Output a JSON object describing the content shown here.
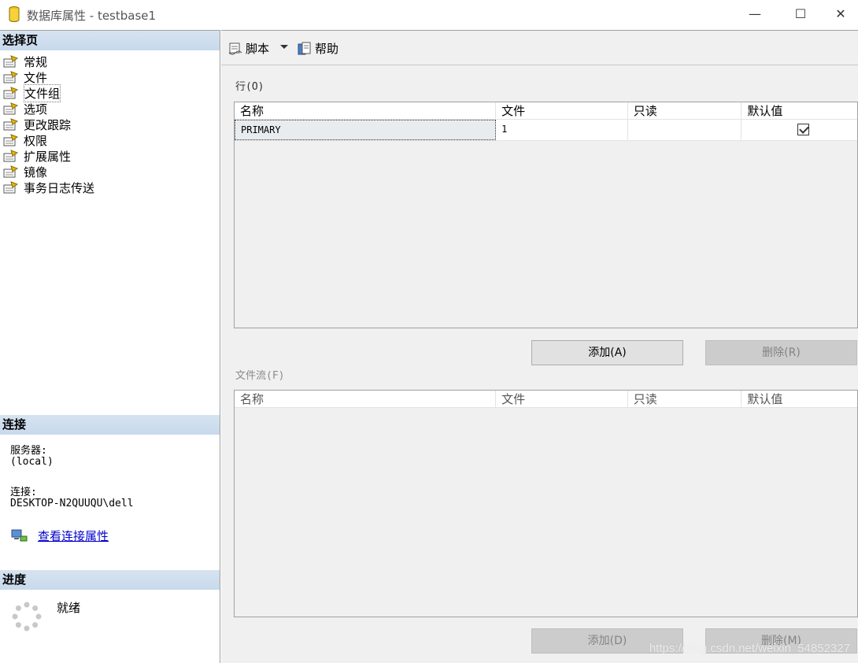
{
  "window": {
    "title": "数据库属性 - testbase1",
    "minimize_glyph": "—",
    "maximize_glyph": "☐",
    "close_glyph": "✕"
  },
  "sidebar": {
    "select_page_header": "选择页",
    "items": [
      {
        "label": "常规"
      },
      {
        "label": "文件"
      },
      {
        "label": "文件组"
      },
      {
        "label": "选项"
      },
      {
        "label": "更改跟踪"
      },
      {
        "label": "权限"
      },
      {
        "label": "扩展属性"
      },
      {
        "label": "镜像"
      },
      {
        "label": "事务日志传送"
      }
    ],
    "selected_index": 2,
    "connection_header": "连接",
    "server_label": "服务器:",
    "server_value": "(local)",
    "connection_label": "连接:",
    "connection_value": "DESKTOP-N2QUUQU\\dell",
    "view_connection_link": "查看连接属性",
    "progress_header": "进度",
    "progress_status": "就绪"
  },
  "toolbar": {
    "script_label": "脚本",
    "help_label": "帮助"
  },
  "rows_grid": {
    "label": "行(O)",
    "columns": [
      "名称",
      "文件",
      "只读",
      "默认值"
    ],
    "rows": [
      {
        "name": "PRIMARY",
        "files": "1",
        "readonly": false,
        "default": true
      }
    ],
    "add_button": "添加(A)",
    "remove_button": "删除(R)"
  },
  "filestream_grid": {
    "label": "文件流(F)",
    "columns": [
      "名称",
      "文件",
      "只读",
      "默认值"
    ],
    "rows": [],
    "add_button": "添加(D)",
    "remove_button": "删除(M)"
  },
  "watermark": "https://blog.csdn.net/weixin_54852327",
  "colors": {
    "header_gradient": "#d6e3f1",
    "link": "#0000cc",
    "pane_bg": "#f0f0f0"
  }
}
